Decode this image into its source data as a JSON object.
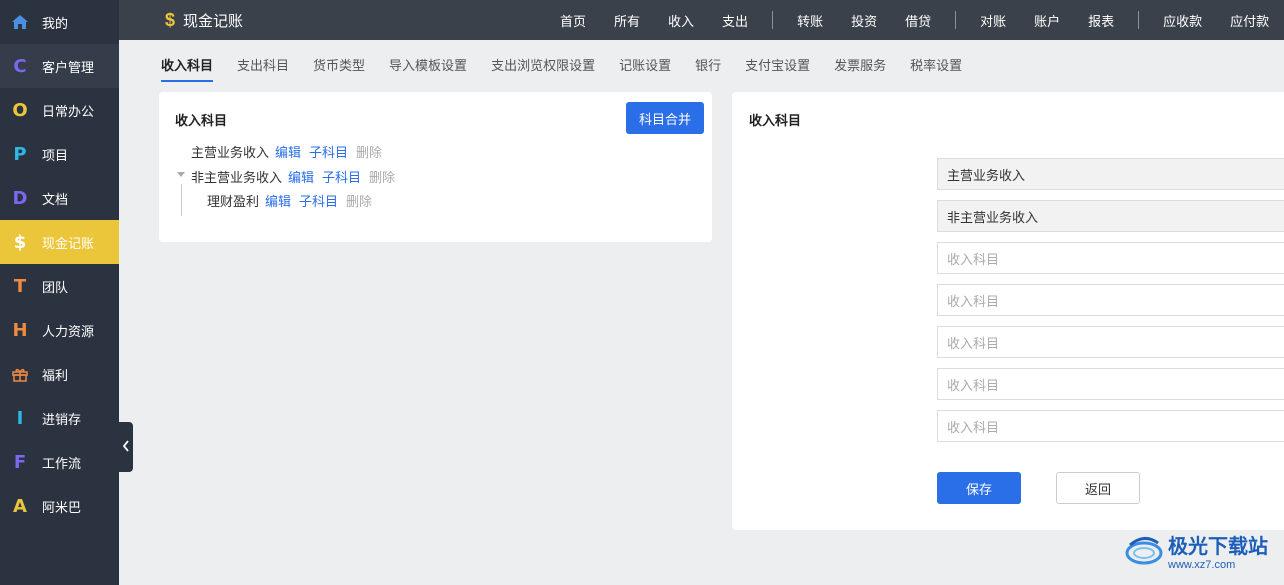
{
  "sidebar": {
    "items": [
      {
        "icon": "home-icon",
        "glyph": "⌂",
        "color": "#4a90e2",
        "label": "我的"
      },
      {
        "icon": "letter-c-icon",
        "glyph": "C",
        "color": "#7b68ee",
        "label": "客户管理"
      },
      {
        "icon": "letter-o-icon",
        "glyph": "O",
        "color": "#ecc63a",
        "label": "日常办公"
      },
      {
        "icon": "letter-p-icon",
        "glyph": "P",
        "color": "#2fb7e5",
        "label": "项目"
      },
      {
        "icon": "letter-d-icon",
        "glyph": "D",
        "color": "#7b68ee",
        "label": "文档"
      },
      {
        "icon": "dollar-icon",
        "glyph": "$",
        "color": "#ffffff",
        "label": "现金记账"
      },
      {
        "icon": "letter-t-icon",
        "glyph": "T",
        "color": "#f08a3e",
        "label": "团队"
      },
      {
        "icon": "letter-h-icon",
        "glyph": "H",
        "color": "#f08a3e",
        "label": "人力资源"
      },
      {
        "icon": "gift-icon",
        "glyph": "🎁",
        "color": "#f08a3e",
        "label": "福利"
      },
      {
        "icon": "letter-i-icon",
        "glyph": "I",
        "color": "#2fb7e5",
        "label": "进销存"
      },
      {
        "icon": "letter-f-icon",
        "glyph": "F",
        "color": "#7b68ee",
        "label": "工作流"
      },
      {
        "icon": "letter-a-icon",
        "glyph": "A",
        "color": "#ecc63a",
        "label": "阿米巴"
      }
    ]
  },
  "header": {
    "app_title": "现金记账",
    "nav": [
      "首页",
      "所有",
      "收入",
      "支出",
      "|",
      "转账",
      "投资",
      "借贷",
      "|",
      "对账",
      "账户",
      "报表",
      "|",
      "应收款",
      "应付款"
    ]
  },
  "subtabs": [
    "收入科目",
    "支出科目",
    "货币类型",
    "导入模板设置",
    "支出浏览权限设置",
    "记账设置",
    "银行",
    "支付宝设置",
    "发票服务",
    "税率设置"
  ],
  "left_panel": {
    "title": "收入科目",
    "merge_button": "科目合并",
    "tree": [
      {
        "name": "主营业务收入",
        "edit": "编辑",
        "child": "子科目",
        "delete": "删除"
      },
      {
        "name": "非主营业务收入",
        "edit": "编辑",
        "child": "子科目",
        "delete": "删除"
      },
      {
        "name": "理财盈利",
        "edit": "编辑",
        "child": "子科目",
        "delete": "删除"
      }
    ]
  },
  "right_panel": {
    "title": "收入科目",
    "fields": [
      {
        "value": "主营业务收入",
        "placeholder": "收入科目"
      },
      {
        "value": "非主营业务收入",
        "placeholder": "收入科目"
      },
      {
        "value": "",
        "placeholder": "收入科目"
      },
      {
        "value": "",
        "placeholder": "收入科目"
      },
      {
        "value": "",
        "placeholder": "收入科目"
      },
      {
        "value": "",
        "placeholder": "收入科目"
      },
      {
        "value": "",
        "placeholder": "收入科目"
      }
    ],
    "save_button": "保存",
    "back_button": "返回"
  },
  "watermark": {
    "name": "极光下载站",
    "url": "www.xz7.com"
  },
  "colors": {
    "accent": "#2a6ee8",
    "active_sidebar": "#ecc63a",
    "sidebar_bg": "#2b3340",
    "topbar_bg": "#3a414b"
  }
}
